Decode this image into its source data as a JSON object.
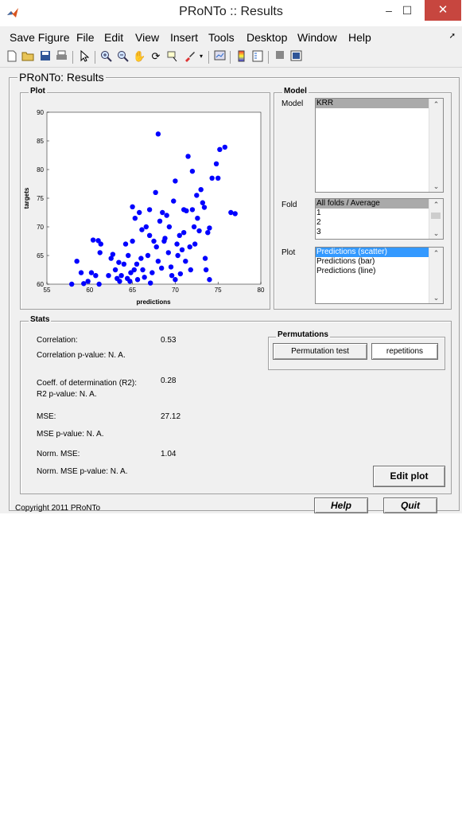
{
  "window": {
    "title": "PRoNTo :: Results",
    "minimize": "–",
    "maximize": "☐",
    "close": "✕"
  },
  "menu": [
    "Save Figure",
    "File",
    "Edit",
    "View",
    "Insert",
    "Tools",
    "Desktop",
    "Window",
    "Help"
  ],
  "panel_title": "PRoNTo: Results",
  "plot_section": {
    "label": "Plot"
  },
  "model_section": {
    "label": "Model",
    "model_label": "Model",
    "model_items": [
      "KRR"
    ],
    "fold_label": "Fold",
    "fold_items": [
      "All folds / Average",
      "1",
      "2",
      "3"
    ],
    "plot_label": "Plot",
    "plot_items": [
      "Predictions (scatter)",
      "Predictions (bar)",
      "Predictions (line)"
    ]
  },
  "stats": {
    "label": "Stats",
    "correlation_label": "Correlation:",
    "correlation_value": "0.53",
    "correlation_p": "Correlation p-value: N. A.",
    "r2_label": "Coeff. of determination (R2):",
    "r2_value": "0.28",
    "r2_p": "R2 p-value: N. A.",
    "mse_label": "MSE:",
    "mse_value": "27.12",
    "mse_p": "MSE p-value: N. A.",
    "nmse_label": "Norm. MSE:",
    "nmse_value": "1.04",
    "nmse_p": "Norm. MSE p-value: N. A."
  },
  "permutations": {
    "label": "Permutations",
    "test_button": "Permutation test",
    "repetitions_button": "repetitions"
  },
  "buttons": {
    "edit_plot": "Edit plot",
    "help": "Help",
    "quit": "Quit"
  },
  "copyright": "Copyright 2011 PRoNTo",
  "colors": {
    "marker": "#0000ff",
    "titlebar_close": "#c7463f",
    "selection_blue": "#3399ff"
  },
  "chart_data": {
    "type": "scatter",
    "xlabel": "predictions",
    "ylabel": "targets",
    "xlim": [
      55,
      80
    ],
    "ylim": [
      60,
      90
    ],
    "xticks": [
      55,
      60,
      65,
      70,
      75,
      80
    ],
    "yticks": [
      60,
      65,
      70,
      75,
      80,
      85,
      90
    ],
    "grid": false,
    "points": [
      [
        57.9,
        60.0
      ],
      [
        58.5,
        64.0
      ],
      [
        59.0,
        62.0
      ],
      [
        59.3,
        60.1
      ],
      [
        59.8,
        60.5
      ],
      [
        60.2,
        62.0
      ],
      [
        60.4,
        67.7
      ],
      [
        60.7,
        61.5
      ],
      [
        61.0,
        67.6
      ],
      [
        61.1,
        60.0
      ],
      [
        61.2,
        65.5
      ],
      [
        61.3,
        67.0
      ],
      [
        62.2,
        61.5
      ],
      [
        62.5,
        64.5
      ],
      [
        62.7,
        65.2
      ],
      [
        63.0,
        62.5
      ],
      [
        63.2,
        61.0
      ],
      [
        63.4,
        63.8
      ],
      [
        63.5,
        60.5
      ],
      [
        63.7,
        61.5
      ],
      [
        64.0,
        63.5
      ],
      [
        64.2,
        67.0
      ],
      [
        64.4,
        61.0
      ],
      [
        64.5,
        65.0
      ],
      [
        64.7,
        60.5
      ],
      [
        64.8,
        62.0
      ],
      [
        65.0,
        73.5
      ],
      [
        65.0,
        67.5
      ],
      [
        65.2,
        62.5
      ],
      [
        65.3,
        71.5
      ],
      [
        65.5,
        63.5
      ],
      [
        65.6,
        60.8
      ],
      [
        65.8,
        72.5
      ],
      [
        66.0,
        64.5
      ],
      [
        66.1,
        69.5
      ],
      [
        66.2,
        62.5
      ],
      [
        66.4,
        61.2
      ],
      [
        66.6,
        70.0
      ],
      [
        66.8,
        65.0
      ],
      [
        67.0,
        73.0
      ],
      [
        67.0,
        68.5
      ],
      [
        67.1,
        60.2
      ],
      [
        67.3,
        62.0
      ],
      [
        67.5,
        67.5
      ],
      [
        67.7,
        76.0
      ],
      [
        67.8,
        66.5
      ],
      [
        68.0,
        86.2
      ],
      [
        68.0,
        64.0
      ],
      [
        68.2,
        71.0
      ],
      [
        68.4,
        62.8
      ],
      [
        68.5,
        72.5
      ],
      [
        68.7,
        67.5
      ],
      [
        68.8,
        68.0
      ],
      [
        69.0,
        72.0
      ],
      [
        69.2,
        65.5
      ],
      [
        69.3,
        70.0
      ],
      [
        69.5,
        63.0
      ],
      [
        69.6,
        61.5
      ],
      [
        69.8,
        74.5
      ],
      [
        70.0,
        78.0
      ],
      [
        70.0,
        60.8
      ],
      [
        70.2,
        67.0
      ],
      [
        70.3,
        65.0
      ],
      [
        70.5,
        68.5
      ],
      [
        70.6,
        61.8
      ],
      [
        70.8,
        66.0
      ],
      [
        71.0,
        73.0
      ],
      [
        71.0,
        69.0
      ],
      [
        71.2,
        64.0
      ],
      [
        71.3,
        72.8
      ],
      [
        71.5,
        82.3
      ],
      [
        71.7,
        66.5
      ],
      [
        71.8,
        62.5
      ],
      [
        72.0,
        79.7
      ],
      [
        72.0,
        73.0
      ],
      [
        72.2,
        70.0
      ],
      [
        72.3,
        67.0
      ],
      [
        72.5,
        75.5
      ],
      [
        72.6,
        71.5
      ],
      [
        72.8,
        69.3
      ],
      [
        73.0,
        76.5
      ],
      [
        73.2,
        74.2
      ],
      [
        73.4,
        73.4
      ],
      [
        73.5,
        64.5
      ],
      [
        73.6,
        62.5
      ],
      [
        73.8,
        69.0
      ],
      [
        74.0,
        69.8
      ],
      [
        74.0,
        60.8
      ],
      [
        74.3,
        78.5
      ],
      [
        74.8,
        81.0
      ],
      [
        75.0,
        78.5
      ],
      [
        75.2,
        83.5
      ],
      [
        75.8,
        83.9
      ],
      [
        76.5,
        72.5
      ],
      [
        77.0,
        72.3
      ]
    ]
  }
}
